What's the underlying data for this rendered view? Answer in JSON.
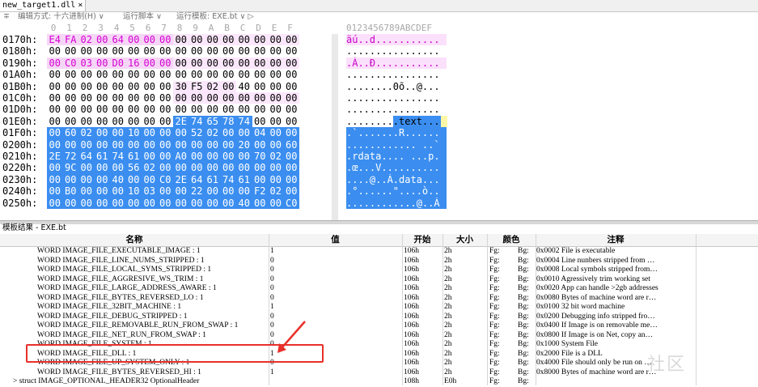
{
  "tab": {
    "title": "new_target1.dll",
    "close": "×"
  },
  "toolbar": {
    "pin": "∓",
    "edit_mode": "编辑方式: 十六进制(H) ∨",
    "run_script": "运行脚本 ∨",
    "run_template": "运行模板: EXE.bt ∨ ▷"
  },
  "hex_header": {
    "cols": [
      "0",
      "1",
      "2",
      "3",
      "4",
      "5",
      "6",
      "7",
      "8",
      "9",
      "A",
      "B",
      "C",
      "D",
      "E",
      "F"
    ],
    "ascii": "0123456789ABCDEF"
  },
  "hex_rows": [
    {
      "addr": "0170h:",
      "bytes": [
        "E4",
        "FA",
        "02",
        "00",
        "64",
        "00",
        "00",
        "00",
        "00",
        "00",
        "00",
        "00",
        "00",
        "00",
        "00",
        "00"
      ],
      "ascii": "äú..d..........."
    },
    {
      "addr": "0180h:",
      "bytes": [
        "00",
        "00",
        "00",
        "00",
        "00",
        "00",
        "00",
        "00",
        "00",
        "00",
        "00",
        "00",
        "00",
        "00",
        "00",
        "00"
      ],
      "ascii": "................"
    },
    {
      "addr": "0190h:",
      "bytes": [
        "00",
        "C0",
        "03",
        "00",
        "D0",
        "16",
        "00",
        "00",
        "00",
        "00",
        "00",
        "00",
        "00",
        "00",
        "00",
        "00"
      ],
      "ascii": ".À..Ð..........."
    },
    {
      "addr": "01A0h:",
      "bytes": [
        "00",
        "00",
        "00",
        "00",
        "00",
        "00",
        "00",
        "00",
        "00",
        "00",
        "00",
        "00",
        "00",
        "00",
        "00",
        "00"
      ],
      "ascii": "................"
    },
    {
      "addr": "01B0h:",
      "bytes": [
        "00",
        "00",
        "00",
        "00",
        "00",
        "00",
        "00",
        "00",
        "30",
        "F5",
        "02",
        "00",
        "40",
        "00",
        "00",
        "00"
      ],
      "ascii": "........0õ..@..."
    },
    {
      "addr": "01C0h:",
      "bytes": [
        "00",
        "00",
        "00",
        "00",
        "00",
        "00",
        "00",
        "00",
        "00",
        "00",
        "00",
        "00",
        "00",
        "00",
        "00",
        "00"
      ],
      "ascii": "................"
    },
    {
      "addr": "01D0h:",
      "bytes": [
        "00",
        "00",
        "00",
        "00",
        "00",
        "00",
        "00",
        "00",
        "00",
        "00",
        "00",
        "00",
        "00",
        "00",
        "00",
        "00"
      ],
      "ascii": "................"
    },
    {
      "addr": "01E0h:",
      "bytes": [
        "00",
        "00",
        "00",
        "00",
        "00",
        "00",
        "00",
        "00",
        "2E",
        "74",
        "65",
        "78",
        "74",
        "00",
        "00",
        "00"
      ],
      "ascii": ".........text..."
    },
    {
      "addr": "01F0h:",
      "bytes": [
        "00",
        "60",
        "02",
        "00",
        "00",
        "10",
        "00",
        "00",
        "00",
        "52",
        "02",
        "00",
        "00",
        "04",
        "00",
        "00"
      ],
      "ascii": ".`.......R......"
    },
    {
      "addr": "0200h:",
      "bytes": [
        "00",
        "00",
        "00",
        "00",
        "00",
        "00",
        "00",
        "00",
        "00",
        "00",
        "00",
        "00",
        "20",
        "00",
        "00",
        "60"
      ],
      "ascii": "............ ..`"
    },
    {
      "addr": "0210h:",
      "bytes": [
        "2E",
        "72",
        "64",
        "61",
        "74",
        "61",
        "00",
        "00",
        "A0",
        "00",
        "00",
        "00",
        "00",
        "70",
        "02",
        "00"
      ],
      "ascii": ".rdata.... ...p."
    },
    {
      "addr": "0220h:",
      "bytes": [
        "00",
        "9C",
        "00",
        "00",
        "00",
        "56",
        "02",
        "00",
        "00",
        "00",
        "00",
        "00",
        "00",
        "00",
        "00",
        "00"
      ],
      "ascii": ".œ...V.........."
    },
    {
      "addr": "0230h:",
      "bytes": [
        "00",
        "00",
        "00",
        "00",
        "40",
        "00",
        "00",
        "C0",
        "2E",
        "64",
        "61",
        "74",
        "61",
        "00",
        "00",
        "00"
      ],
      "ascii": "....@..À.data..."
    },
    {
      "addr": "0240h:",
      "bytes": [
        "00",
        "B0",
        "00",
        "00",
        "00",
        "10",
        "03",
        "00",
        "00",
        "22",
        "00",
        "00",
        "00",
        "F2",
        "02",
        "00"
      ],
      "ascii": ".°......\"....ò.."
    },
    {
      "addr": "0250h:",
      "bytes": [
        "00",
        "00",
        "00",
        "00",
        "00",
        "00",
        "00",
        "00",
        "00",
        "00",
        "00",
        "00",
        "40",
        "00",
        "00",
        "C0"
      ],
      "ascii": "............@..À"
    }
  ],
  "panel": {
    "title": "模板结果 - EXE.bt"
  },
  "columns": {
    "name": "名称",
    "value": "值",
    "start": "开始",
    "size": "大小",
    "color": "颜色",
    "comment": "注释"
  },
  "rows": [
    {
      "name": "WORD IMAGE_FILE_EXECUTABLE_IMAGE : 1",
      "value": "1",
      "start": "106h",
      "size": "2h",
      "fg": "Fg:",
      "bg": "Bg:",
      "comment": "0x0002  File is executable"
    },
    {
      "name": "WORD IMAGE_FILE_LINE_NUMS_STRIPPED : 1",
      "value": "0",
      "start": "106h",
      "size": "2h",
      "fg": "Fg:",
      "bg": "Bg:",
      "comment": "0x0004  Line nunbers stripped from …"
    },
    {
      "name": "WORD IMAGE_FILE_LOCAL_SYMS_STRIPPED : 1",
      "value": "0",
      "start": "106h",
      "size": "2h",
      "fg": "Fg:",
      "bg": "Bg:",
      "comment": "0x0008  Local symbols stripped from…"
    },
    {
      "name": "WORD IMAGE_FILE_AGGRESIVE_WS_TRIM : 1",
      "value": "0",
      "start": "106h",
      "size": "2h",
      "fg": "Fg:",
      "bg": "Bg:",
      "comment": "0x0010  Agressively trim working set"
    },
    {
      "name": "WORD IMAGE_FILE_LARGE_ADDRESS_AWARE : 1",
      "value": "0",
      "start": "106h",
      "size": "2h",
      "fg": "Fg:",
      "bg": "Bg:",
      "comment": "0x0020  App can handle >2gb addresses"
    },
    {
      "name": "WORD IMAGE_FILE_BYTES_REVERSED_LO : 1",
      "value": "0",
      "start": "106h",
      "size": "2h",
      "fg": "Fg:",
      "bg": "Bg:",
      "comment": "0x0080  Bytes of machine word are r…"
    },
    {
      "name": "WORD IMAGE_FILE_32BIT_MACHINE : 1",
      "value": "1",
      "start": "106h",
      "size": "2h",
      "fg": "Fg:",
      "bg": "Bg:",
      "comment": "0x0100  32 bit word machine"
    },
    {
      "name": "WORD IMAGE_FILE_DEBUG_STRIPPED : 1",
      "value": "0",
      "start": "106h",
      "size": "2h",
      "fg": "Fg:",
      "bg": "Bg:",
      "comment": "0x0200  Debugging info stripped fro…"
    },
    {
      "name": "WORD IMAGE_FILE_REMOVABLE_RUN_FROM_SWAP : 1",
      "value": "0",
      "start": "106h",
      "size": "2h",
      "fg": "Fg:",
      "bg": "Bg:",
      "comment": "0x0400  If Image is on removable me…"
    },
    {
      "name": "WORD IMAGE_FILE_NET_RUN_FROM_SWAP : 1",
      "value": "0",
      "start": "106h",
      "size": "2h",
      "fg": "Fg:",
      "bg": "Bg:",
      "comment": "0x0800  If Image is on Net, copy an…"
    },
    {
      "name": "WORD IMAGE_FILE_SYSTEM : 1",
      "value": "0",
      "start": "106h",
      "size": "2h",
      "fg": "Fg:",
      "bg": "Bg:",
      "comment": "0x1000  System File"
    },
    {
      "name": "WORD IMAGE_FILE_DLL : 1",
      "value": "1",
      "start": "106h",
      "size": "2h",
      "fg": "Fg:",
      "bg": "Bg:",
      "comment": "0x2000  File is a DLL"
    },
    {
      "name": "WORD IMAGE_FILE_UP_SYSTEM_ONLY : 1",
      "value": "0",
      "start": "106h",
      "size": "2h",
      "fg": "Fg:",
      "bg": "Bg:",
      "comment": "0x4000  File should only be run on …"
    },
    {
      "name": "WORD IMAGE_FILE_BYTES_REVERSED_HI : 1",
      "value": "1",
      "start": "106h",
      "size": "2h",
      "fg": "Fg:",
      "bg": "Bg:",
      "comment": "0x8000  Bytes of machine word are r…"
    },
    {
      "name": "> struct IMAGE_OPTIONAL_HEADER32 OptionalHeader",
      "value": "",
      "start": "108h",
      "size": "E0h",
      "fg": "Fg:",
      "bg": "Bg:",
      "comment": ""
    }
  ],
  "annotation": {
    "color": "#e8302a"
  },
  "watermark": "社区"
}
